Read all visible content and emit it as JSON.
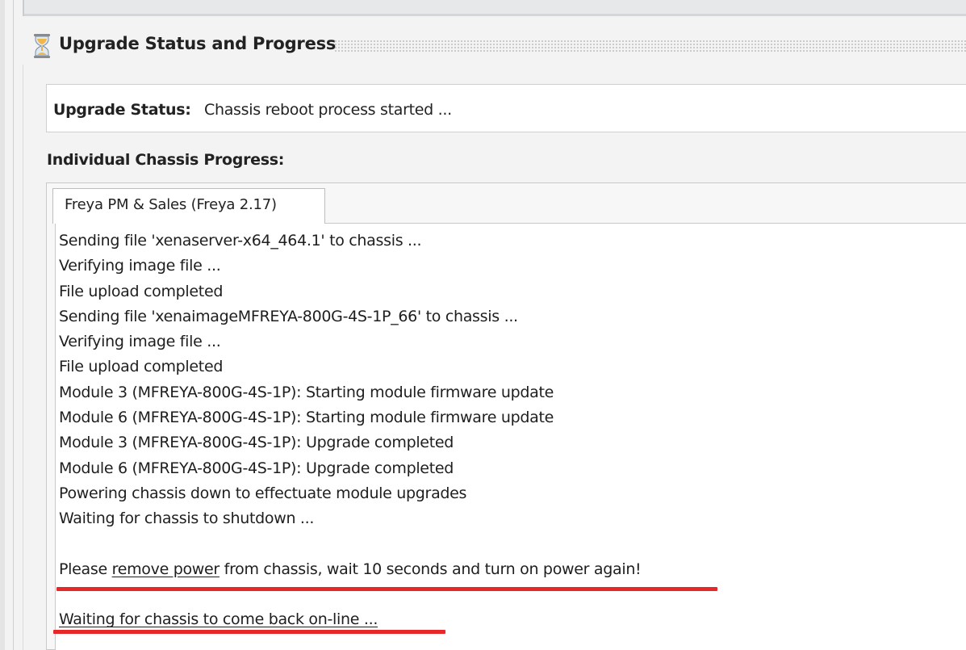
{
  "section": {
    "title": "Upgrade Status and Progress",
    "icon": "hourglass-icon"
  },
  "upgrade_status": {
    "label": "Upgrade Status:",
    "value": "Chassis reboot process started ..."
  },
  "progress": {
    "heading": "Individual Chassis Progress:",
    "tab_label": "Freya PM & Sales (Freya 2.17)",
    "log": [
      "Sending file 'xenaserver-x64_464.1' to chassis ...",
      "Verifying image file ...",
      "File upload completed",
      "Sending file 'xenaimageMFREYA-800G-4S-1P_66' to chassis ...",
      "Verifying image file ...",
      "File upload completed",
      "Module 3 (MFREYA-800G-4S-1P): Starting module firmware update",
      "Module 6 (MFREYA-800G-4S-1P): Starting module firmware update",
      "Module 3 (MFREYA-800G-4S-1P): Upgrade completed",
      "Module 6 (MFREYA-800G-4S-1P): Upgrade completed",
      "Powering chassis down to effectuate module upgrades",
      "Waiting for chassis to shutdown ..."
    ],
    "power_message": {
      "before": "Please ",
      "underlined": "remove power",
      "after": " from chassis, wait 10 seconds and turn on power again!"
    },
    "final_line": "Waiting for chassis to come back on-line ..."
  },
  "colors": {
    "highlight_red": "#e62828"
  }
}
